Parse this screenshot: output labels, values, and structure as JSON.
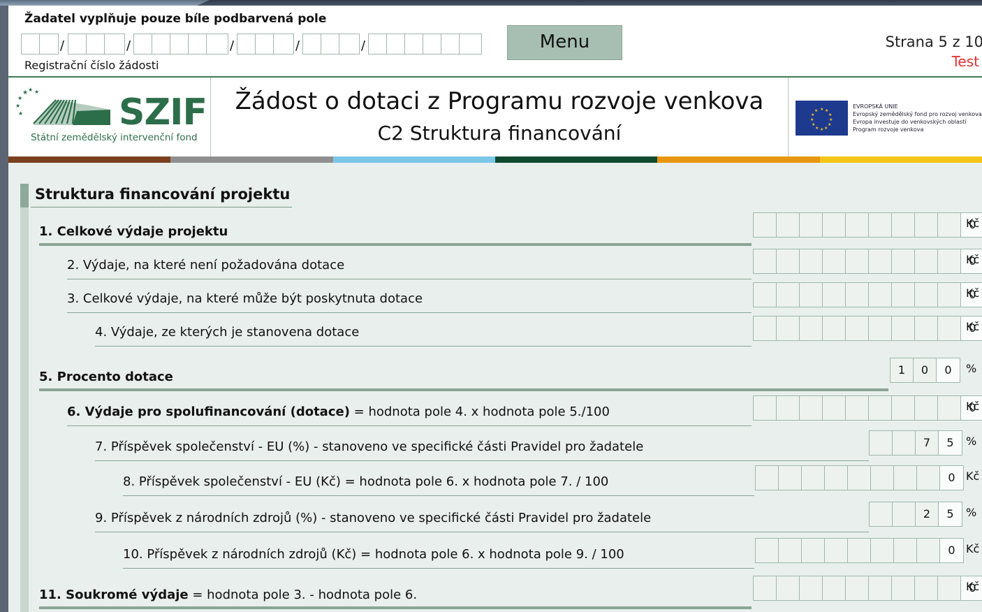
{
  "header": {
    "instruction": "Žadatel vyplňuje pouze bíle podbarvená pole",
    "reg_caption": "Registrační číslo žádosti",
    "menu_label": "Menu",
    "page_info": "Strana 5 z 10",
    "test_label": "Test"
  },
  "banner": {
    "logo_text": "SZIF",
    "logo_sub": "Státní zemědělský intervenční fond",
    "title": "Žádost o dotaci z Programu rozvoje venkova",
    "subtitle": "C2 Struktura financování",
    "eu_lines": [
      "EVROPSKÁ UNIE",
      "Evropský zemědělský fond pro rozvoj venkova:",
      "Evropa investuje do venkovských oblastí",
      "Program rozvoje venkova"
    ]
  },
  "colors": {
    "bar": [
      "#7b3f1e",
      "#8f8f8f",
      "#7cc6e8",
      "#0f4a2f",
      "#e8960f",
      "#f5c518"
    ],
    "accent": "#2c6e49",
    "test_red": "#e03030"
  },
  "section": {
    "title": "Struktura financování projektu"
  },
  "rows": [
    {
      "label": "1. Celkové výdaje projektu",
      "value": "0",
      "unit": "Kč"
    },
    {
      "label": "2. Výdaje, na které není požadována dotace",
      "value": "0",
      "unit": "Kč"
    },
    {
      "label": "3. Celkové výdaje, na které může být poskytnuta dotace",
      "value": "0",
      "unit": "Kč"
    },
    {
      "label": "4. Výdaje, ze kterých je stanovena dotace",
      "value": "0",
      "unit": "Kč"
    },
    {
      "label": "5. Procento dotace",
      "digits": [
        "1",
        "0",
        "0"
      ],
      "unit": "%"
    },
    {
      "label_bold": "6. Výdaje pro spolufinancování (dotace)",
      "label_rest": " = hodnota pole 4. x hodnota pole 5./100",
      "value": "0",
      "unit": "Kč"
    },
    {
      "label": "7. Příspěvek společenství - EU (%) - stanoveno ve specifické části Pravidel pro žadatele",
      "digits": [
        "7",
        "5"
      ],
      "unit": "%"
    },
    {
      "label": "8. Příspěvek společenství - EU (Kč) = hodnota pole 6. x hodnota pole 7. / 100",
      "value": "0",
      "unit": "Kč"
    },
    {
      "label": "9. Příspěvek z národních zdrojů (%)  - stanoveno ve specifické části Pravidel pro žadatele",
      "digits": [
        "2",
        "5"
      ],
      "unit": "%"
    },
    {
      "label": "10. Příspěvek z národních zdrojů (Kč) = hodnota pole 6. x hodnota pole 9. / 100",
      "value": "0",
      "unit": "Kč"
    },
    {
      "label_bold": "11. Soukromé výdaje",
      "label_rest": " = hodnota pole 3. - hodnota pole 6.",
      "value": "0",
      "unit": "Kč"
    }
  ]
}
